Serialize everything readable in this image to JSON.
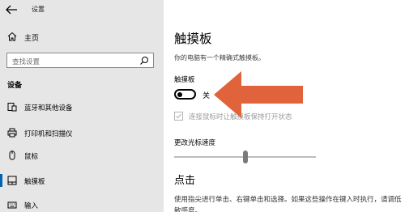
{
  "window": {
    "title": "设置"
  },
  "sidebar": {
    "home_label": "主页",
    "search_placeholder": "查找设置",
    "section_title": "设备",
    "items": [
      {
        "label": "蓝牙和其他设备",
        "icon": "bluetooth-devices-icon"
      },
      {
        "label": "打印机和扫描仪",
        "icon": "printer-icon"
      },
      {
        "label": "鼠标",
        "icon": "mouse-icon"
      },
      {
        "label": "触摸板",
        "icon": "touchpad-icon",
        "active": true
      },
      {
        "label": "输入",
        "icon": "keyboard-icon"
      }
    ]
  },
  "main": {
    "title": "触摸板",
    "subtitle": "你的电脑有一个精确式触摸板。",
    "touchpad_label": "触摸板",
    "toggle_state": "关",
    "toggle_on": false,
    "checkbox_label": "连接鼠标时让触摸板保持打开状态",
    "checkbox_checked": true,
    "checkbox_disabled": true,
    "speed_label": "更改光标速度",
    "speed_value": 0.5,
    "click_header": "点击",
    "click_description": "使用指尖进行单击、右键单击和选择。如果这些操作在键入时执行，请调低敏感度。"
  },
  "colors": {
    "accent": "#0063b1",
    "arrow": "#e0633c",
    "sidebar_bg": "#e6e6e6"
  }
}
